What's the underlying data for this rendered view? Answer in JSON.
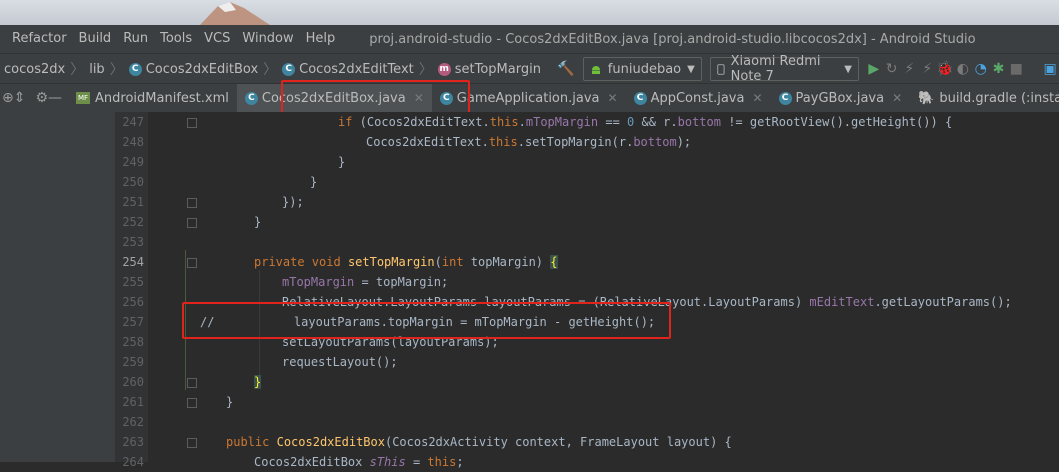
{
  "menubar": {
    "items": [
      "Refactor",
      "Build",
      "Run",
      "Tools",
      "VCS",
      "Window",
      "Help"
    ],
    "window_title": "proj.android-studio - Cocos2dxEditBox.java [proj.android-studio.libcocos2dx] - Android Studio"
  },
  "navbar": {
    "crumbs": [
      "cocos2dx",
      "lib",
      "Cocos2dxEditBox",
      "Cocos2dxEditText",
      "setTopMargin"
    ],
    "module_combo": "funiudebao",
    "device_combo": "Xiaomi Redmi Note 7"
  },
  "tabs": [
    {
      "label": "AndroidManifest.xml",
      "icon": "xml-file-icon",
      "xml_icon_text": "MF"
    },
    {
      "label": "Cocos2dxEditBox.java",
      "icon": "class-icon",
      "active": true
    },
    {
      "label": "GameApplication.java",
      "icon": "class-icon"
    },
    {
      "label": "AppConst.java",
      "icon": "class-icon"
    },
    {
      "label": "PayGBox.java",
      "icon": "class-icon"
    },
    {
      "label": "build.gradle (:instantap",
      "icon": "gradle-icon"
    }
  ],
  "icons": {
    "class_letter": "C",
    "method_letter": "m"
  },
  "code_lines": [
    {
      "n": "247",
      "text": "if (Cocos2dxEditText.this.mTopMargin == 0 && r.bottom != getRootView().getHeight()) {"
    },
    {
      "n": "248",
      "text": "Cocos2dxEditText.this.setTopMargin(r.bottom);"
    },
    {
      "n": "249",
      "text": "}"
    },
    {
      "n": "250",
      "text": "}"
    },
    {
      "n": "251",
      "text": "});"
    },
    {
      "n": "252",
      "text": "}"
    },
    {
      "n": "253",
      "text": ""
    },
    {
      "n": "254",
      "text": "private void setTopMargin(int topMargin) {"
    },
    {
      "n": "255",
      "text": "mTopMargin = topMargin;"
    },
    {
      "n": "256",
      "text": "RelativeLayout.LayoutParams layoutParams = (RelativeLayout.LayoutParams) mEditText.getLayoutParams();"
    },
    {
      "n": "257",
      "text": "//           layoutParams.topMargin = mTopMargin - getHeight();"
    },
    {
      "n": "258",
      "text": "setLayoutParams(layoutParams);"
    },
    {
      "n": "259",
      "text": "requestLayout();"
    },
    {
      "n": "260",
      "text": "}"
    },
    {
      "n": "261",
      "text": "}"
    },
    {
      "n": "262",
      "text": ""
    },
    {
      "n": "263",
      "text": "public Cocos2dxEditBox(Cocos2dxActivity context, FrameLayout layout) {"
    },
    {
      "n": "264",
      "text": "Cocos2dxEditBox sThis = this;"
    }
  ],
  "colors": {
    "annotation_red": "#e0241b",
    "editor_bg": "#2b2b2b",
    "keyword": "#cc7832",
    "field": "#9876aa",
    "method": "#ffc66d"
  }
}
